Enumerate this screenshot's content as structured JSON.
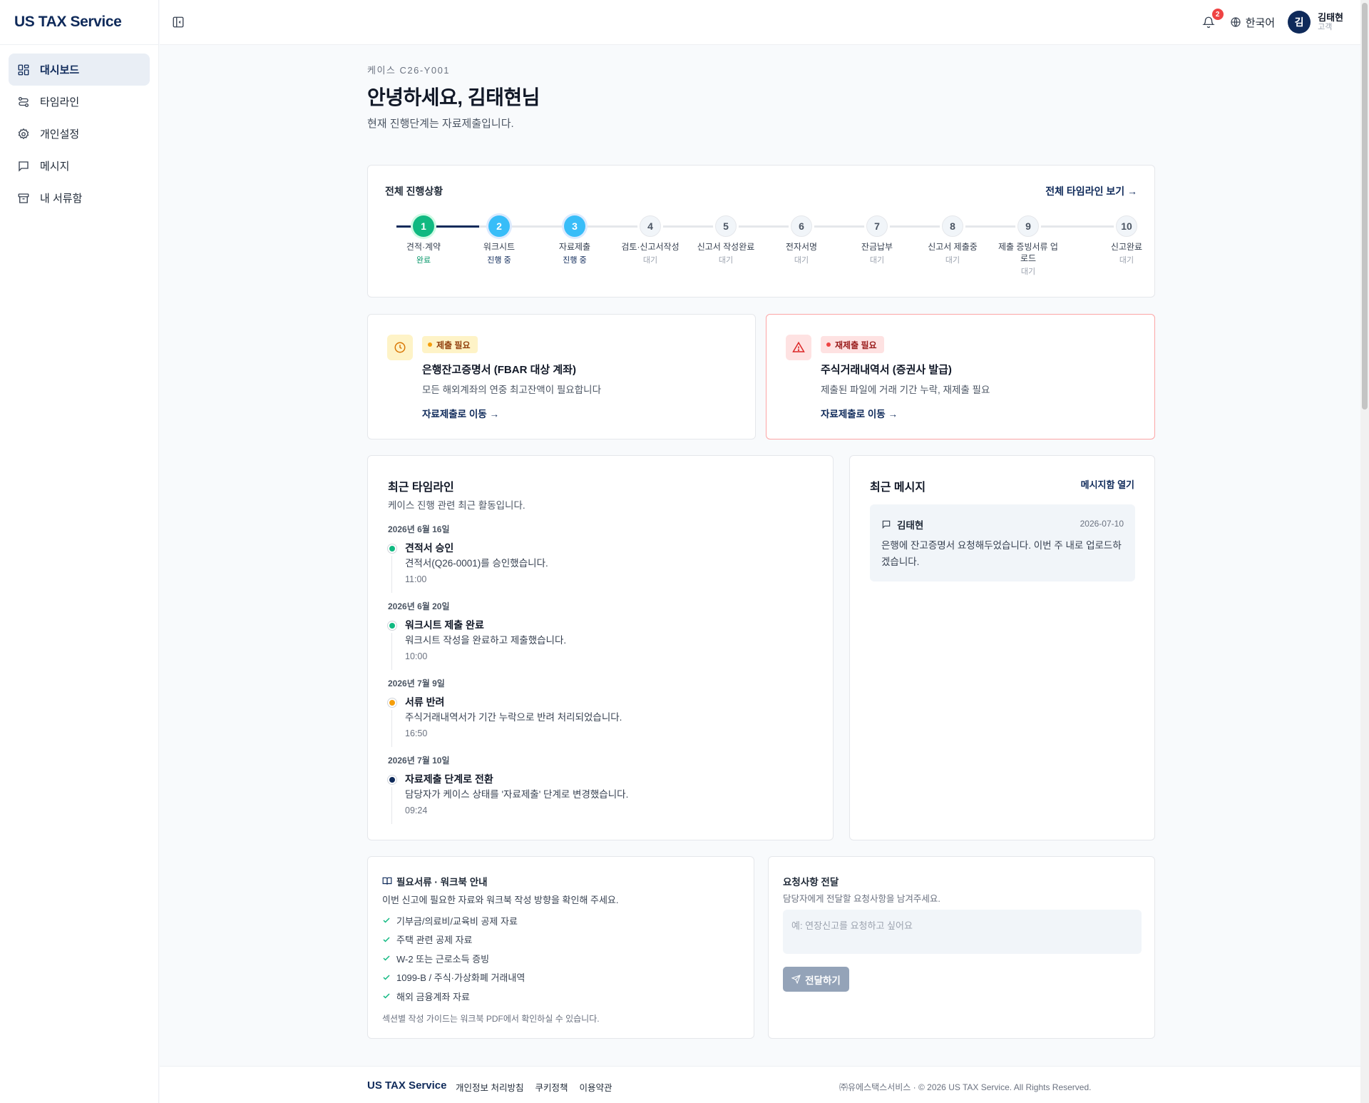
{
  "brand": "US TAX Service",
  "sidebar": {
    "items": [
      {
        "label": "대시보드",
        "icon": "dashboard-icon",
        "active": true
      },
      {
        "label": "타임라인",
        "icon": "timeline-icon",
        "active": false
      },
      {
        "label": "개인설정",
        "icon": "gear-icon",
        "active": false
      },
      {
        "label": "메시지",
        "icon": "message-icon",
        "active": false
      },
      {
        "label": "내 서류함",
        "icon": "archive-icon",
        "active": false
      }
    ]
  },
  "topbar": {
    "notification_count": "2",
    "language": "한국어",
    "avatar_initial": "김",
    "user_name": "김태현",
    "user_role": "고객"
  },
  "header": {
    "case_label": "케이스 C26-Y001",
    "greeting": "안녕하세요, 김태현님",
    "subtitle": "현재 진행단계는 자료제출입니다."
  },
  "progress": {
    "title": "전체 진행상황",
    "link": "전체 타임라인 보기 →",
    "steps": [
      {
        "num": "1",
        "label": "견적·계약",
        "status": "완료",
        "state": "done"
      },
      {
        "num": "2",
        "label": "워크시트",
        "status": "진행 중",
        "state": "active"
      },
      {
        "num": "3",
        "label": "자료제출",
        "status": "진행 중",
        "state": "active"
      },
      {
        "num": "4",
        "label": "검토·신고서작성",
        "status": "대기",
        "state": "wait"
      },
      {
        "num": "5",
        "label": "신고서 작성완료",
        "status": "대기",
        "state": "wait"
      },
      {
        "num": "6",
        "label": "전자서명",
        "status": "대기",
        "state": "wait"
      },
      {
        "num": "7",
        "label": "잔금납부",
        "status": "대기",
        "state": "wait"
      },
      {
        "num": "8",
        "label": "신고서 제출중",
        "status": "대기",
        "state": "wait"
      },
      {
        "num": "9",
        "label": "제출 증빙서류 업로드",
        "status": "대기",
        "state": "wait"
      },
      {
        "num": "10",
        "label": "신고완료",
        "status": "대기",
        "state": "wait"
      }
    ]
  },
  "alerts": [
    {
      "tag": "제출 필요",
      "title": "은행잔고증명서 (FBAR 대상 계좌)",
      "desc": "모든 해외계좌의 연중 최고잔액이 필요합니다",
      "link": "자료제출로 이동 →",
      "color": "#f59e0b"
    },
    {
      "tag": "재제출 필요",
      "title": "주식거래내역서 (증권사 발급)",
      "desc": "제출된 파일에 거래 기간 누락, 재제출 필요",
      "link": "자료제출로 이동 →",
      "color": "#ef4444"
    }
  ],
  "timeline": {
    "title": "최근 타임라인",
    "subtitle": "케이스 진행 관련 최근 활동입니다.",
    "groups": [
      {
        "date": "2026년 6월 16일",
        "title": "견적서 승인",
        "desc": "견적서(Q26-0001)를 승인했습니다.",
        "time": "11:00",
        "color": "#10b981"
      },
      {
        "date": "2026년 6월 20일",
        "title": "워크시트 제출 완료",
        "desc": "워크시트 작성을 완료하고 제출했습니다.",
        "time": "10:00",
        "color": "#10b981"
      },
      {
        "date": "2026년 7월 9일",
        "title": "서류 반려",
        "desc": "주식거래내역서가 기간 누락으로 반려 처리되었습니다.",
        "time": "16:50",
        "color": "#f59e0b"
      },
      {
        "date": "2026년 7월 10일",
        "title": "자료제출 단계로 전환",
        "desc": "담당자가 케이스 상태를 '자료제출' 단계로 변경했습니다.",
        "time": "09:24",
        "color": "#0f2a5a"
      }
    ]
  },
  "messages": {
    "title": "최근 메시지",
    "link": "메시지함 열기",
    "items": [
      {
        "from": "김태현",
        "date": "2026-07-10",
        "text": "은행에 잔고증명서 요청해두었습니다. 이번 주 내로 업로드하겠습니다."
      }
    ]
  },
  "guide": {
    "title": "필요서류 · 워크북 안내",
    "subtitle": "이번 신고에 필요한 자료와 워크북 작성 방향을 확인해 주세요.",
    "items": [
      "기부금/의료비/교육비 공제 자료",
      "주택 관련 공제 자료",
      "W-2 또는 근로소득 증빙",
      "1099-B / 주식·가상화폐 거래내역",
      "해외 금융계좌 자료"
    ],
    "note": "섹션별 작성 가이드는 워크북 PDF에서 확인하실 수 있습니다."
  },
  "request": {
    "title": "요청사항 전달",
    "subtitle": "담당자에게 전달할 요청사항을 남겨주세요.",
    "placeholder": "예: 연장신고를 요청하고 싶어요",
    "button": "전달하기"
  },
  "footer": {
    "brand": "US TAX Service",
    "links": [
      "개인정보 처리방침",
      "쿠키정책",
      "이용약관"
    ],
    "copyright": "㈜유에스택스서비스 · © 2026 US TAX Service. All Rights Reserved."
  }
}
